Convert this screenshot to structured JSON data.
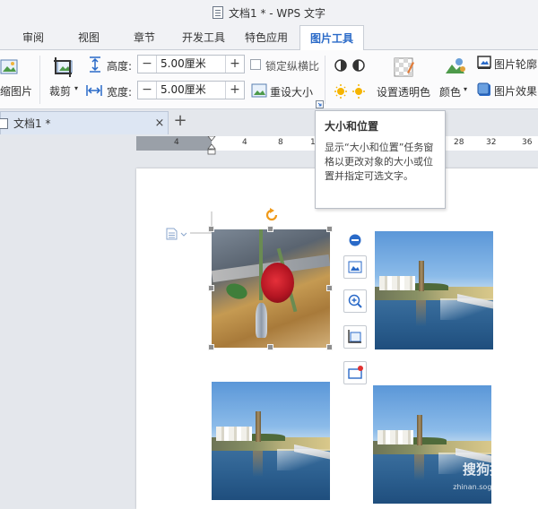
{
  "window": {
    "title": "文档1 * - WPS 文字"
  },
  "menu": {
    "tabs": [
      {
        "label": "审阅"
      },
      {
        "label": "视图"
      },
      {
        "label": "章节"
      },
      {
        "label": "开发工具"
      },
      {
        "label": "特色应用"
      },
      {
        "label": "图片工具"
      }
    ],
    "active_tab": "图片工具"
  },
  "ribbon": {
    "compress_label": "缩图片",
    "crop_label": "裁剪",
    "height_label": "高度:",
    "height_value": "5.00厘米",
    "width_label": "宽度:",
    "width_value": "5.00厘米",
    "minus": "−",
    "plus": "+",
    "lock_ratio_label": "锁定纵横比",
    "reset_size_label": "重设大小",
    "transparent_label": "设置透明色",
    "color_label": "颜色",
    "outline_label": "图片轮廓",
    "effect_label": "图片效果"
  },
  "doc_tabs": {
    "tab_label": "文档1 *",
    "close": "×",
    "new_tab": "+"
  },
  "ruler": {
    "numbers": [
      "4",
      "4",
      "8",
      "12",
      "16",
      "20",
      "24",
      "28",
      "32",
      "36"
    ]
  },
  "tooltip": {
    "title": "大小和位置",
    "body": "显示“大小和位置”任务窗格以更改对象的大小或位置并指定可选文字。"
  },
  "watermark": {
    "text": "搜狗指南",
    "sub": "zhinan.sogou.com"
  },
  "colors": {
    "accent": "#2a6ac8",
    "page": "#ffffff",
    "workspace": "#e4e7ec"
  }
}
